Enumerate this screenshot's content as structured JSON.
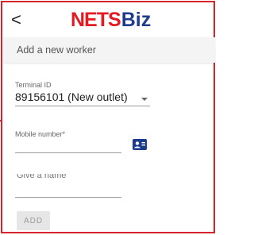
{
  "header": {
    "back_glyph": "<",
    "logo_part1": "NETS",
    "logo_part2": "Biz",
    "subtitle": "Add a new worker"
  },
  "form": {
    "terminal": {
      "label": "Terminal ID",
      "value": "89156101 (New outlet)"
    },
    "mobile": {
      "label": "Mobile number*",
      "value": ""
    },
    "name": {
      "label": "Give a name",
      "value": ""
    },
    "add_label": "ADD"
  },
  "colors": {
    "brand_red": "#e41b23",
    "brand_blue": "#1d3c8e",
    "contact_icon": "#1d3c8e"
  },
  "icons": {
    "back": "chevron-left-icon",
    "dropdown": "caret-down-icon",
    "contact": "contact-card-icon"
  }
}
